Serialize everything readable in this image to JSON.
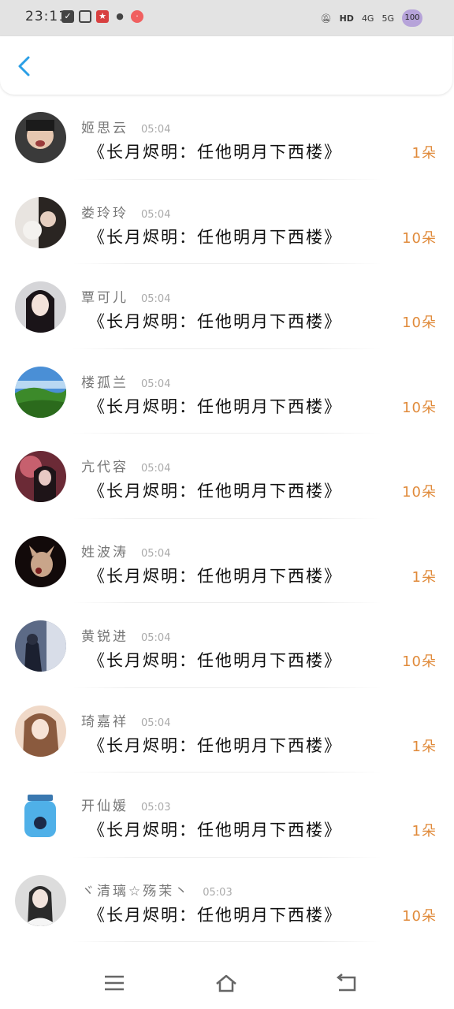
{
  "status_bar": {
    "time": "23:11",
    "network_label": "4G",
    "network_label_2": "5G",
    "battery": "100"
  },
  "records": [
    {
      "name": "姬思云",
      "time": "05:04",
      "title": "《长月烬明：任他明月下西楼》",
      "count": "1朵"
    },
    {
      "name": "娄玲玲",
      "time": "05:04",
      "title": "《长月烬明：任他明月下西楼》",
      "count": "10朵"
    },
    {
      "name": "覃可儿",
      "time": "05:04",
      "title": "《长月烬明：任他明月下西楼》",
      "count": "10朵"
    },
    {
      "name": "楼孤兰",
      "time": "05:04",
      "title": "《长月烬明：任他明月下西楼》",
      "count": "10朵"
    },
    {
      "name": "亢代容",
      "time": "05:04",
      "title": "《长月烬明：任他明月下西楼》",
      "count": "10朵"
    },
    {
      "name": "姓波涛",
      "time": "05:04",
      "title": "《长月烬明：任他明月下西楼》",
      "count": "1朵"
    },
    {
      "name": "黄锐进",
      "time": "05:04",
      "title": "《长月烬明：任他明月下西楼》",
      "count": "10朵"
    },
    {
      "name": "琦嘉祥",
      "time": "05:04",
      "title": "《长月烬明：任他明月下西楼》",
      "count": "1朵"
    },
    {
      "name": "开仙媛",
      "time": "05:03",
      "title": "《长月烬明：任他明月下西楼》",
      "count": "1朵"
    },
    {
      "name": "ヾ清璃☆殇茉丶",
      "time": "05:03",
      "title": "《长月烬明：任他明月下西楼》",
      "count": "10朵"
    }
  ],
  "colors": {
    "accent": "#2b9fe6",
    "count": "#e08a3a"
  },
  "icons": {
    "back": "back-chevron-icon",
    "nav_menu": "menu-icon",
    "nav_home": "home-icon",
    "nav_back": "return-icon"
  }
}
